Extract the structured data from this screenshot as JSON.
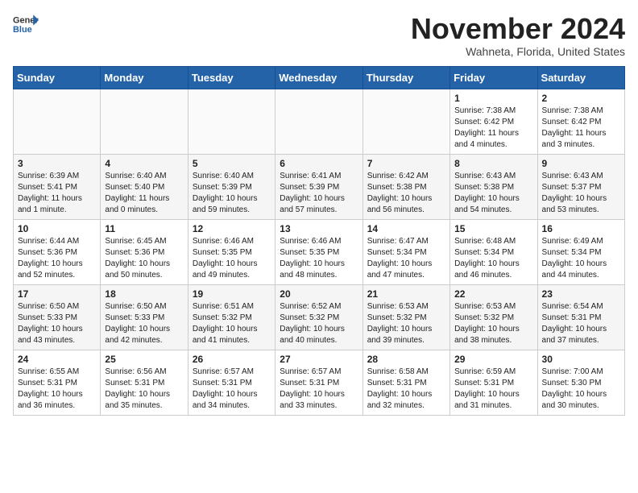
{
  "header": {
    "logo_general": "General",
    "logo_blue": "Blue",
    "month_title": "November 2024",
    "location": "Wahneta, Florida, United States"
  },
  "weekdays": [
    "Sunday",
    "Monday",
    "Tuesday",
    "Wednesday",
    "Thursday",
    "Friday",
    "Saturday"
  ],
  "weeks": [
    [
      {
        "day": "",
        "info": ""
      },
      {
        "day": "",
        "info": ""
      },
      {
        "day": "",
        "info": ""
      },
      {
        "day": "",
        "info": ""
      },
      {
        "day": "",
        "info": ""
      },
      {
        "day": "1",
        "info": "Sunrise: 7:38 AM\nSunset: 6:42 PM\nDaylight: 11 hours\nand 4 minutes."
      },
      {
        "day": "2",
        "info": "Sunrise: 7:38 AM\nSunset: 6:42 PM\nDaylight: 11 hours\nand 3 minutes."
      }
    ],
    [
      {
        "day": "3",
        "info": "Sunrise: 6:39 AM\nSunset: 5:41 PM\nDaylight: 11 hours\nand 1 minute."
      },
      {
        "day": "4",
        "info": "Sunrise: 6:40 AM\nSunset: 5:40 PM\nDaylight: 11 hours\nand 0 minutes."
      },
      {
        "day": "5",
        "info": "Sunrise: 6:40 AM\nSunset: 5:39 PM\nDaylight: 10 hours\nand 59 minutes."
      },
      {
        "day": "6",
        "info": "Sunrise: 6:41 AM\nSunset: 5:39 PM\nDaylight: 10 hours\nand 57 minutes."
      },
      {
        "day": "7",
        "info": "Sunrise: 6:42 AM\nSunset: 5:38 PM\nDaylight: 10 hours\nand 56 minutes."
      },
      {
        "day": "8",
        "info": "Sunrise: 6:43 AM\nSunset: 5:38 PM\nDaylight: 10 hours\nand 54 minutes."
      },
      {
        "day": "9",
        "info": "Sunrise: 6:43 AM\nSunset: 5:37 PM\nDaylight: 10 hours\nand 53 minutes."
      }
    ],
    [
      {
        "day": "10",
        "info": "Sunrise: 6:44 AM\nSunset: 5:36 PM\nDaylight: 10 hours\nand 52 minutes."
      },
      {
        "day": "11",
        "info": "Sunrise: 6:45 AM\nSunset: 5:36 PM\nDaylight: 10 hours\nand 50 minutes."
      },
      {
        "day": "12",
        "info": "Sunrise: 6:46 AM\nSunset: 5:35 PM\nDaylight: 10 hours\nand 49 minutes."
      },
      {
        "day": "13",
        "info": "Sunrise: 6:46 AM\nSunset: 5:35 PM\nDaylight: 10 hours\nand 48 minutes."
      },
      {
        "day": "14",
        "info": "Sunrise: 6:47 AM\nSunset: 5:34 PM\nDaylight: 10 hours\nand 47 minutes."
      },
      {
        "day": "15",
        "info": "Sunrise: 6:48 AM\nSunset: 5:34 PM\nDaylight: 10 hours\nand 46 minutes."
      },
      {
        "day": "16",
        "info": "Sunrise: 6:49 AM\nSunset: 5:34 PM\nDaylight: 10 hours\nand 44 minutes."
      }
    ],
    [
      {
        "day": "17",
        "info": "Sunrise: 6:50 AM\nSunset: 5:33 PM\nDaylight: 10 hours\nand 43 minutes."
      },
      {
        "day": "18",
        "info": "Sunrise: 6:50 AM\nSunset: 5:33 PM\nDaylight: 10 hours\nand 42 minutes."
      },
      {
        "day": "19",
        "info": "Sunrise: 6:51 AM\nSunset: 5:32 PM\nDaylight: 10 hours\nand 41 minutes."
      },
      {
        "day": "20",
        "info": "Sunrise: 6:52 AM\nSunset: 5:32 PM\nDaylight: 10 hours\nand 40 minutes."
      },
      {
        "day": "21",
        "info": "Sunrise: 6:53 AM\nSunset: 5:32 PM\nDaylight: 10 hours\nand 39 minutes."
      },
      {
        "day": "22",
        "info": "Sunrise: 6:53 AM\nSunset: 5:32 PM\nDaylight: 10 hours\nand 38 minutes."
      },
      {
        "day": "23",
        "info": "Sunrise: 6:54 AM\nSunset: 5:31 PM\nDaylight: 10 hours\nand 37 minutes."
      }
    ],
    [
      {
        "day": "24",
        "info": "Sunrise: 6:55 AM\nSunset: 5:31 PM\nDaylight: 10 hours\nand 36 minutes."
      },
      {
        "day": "25",
        "info": "Sunrise: 6:56 AM\nSunset: 5:31 PM\nDaylight: 10 hours\nand 35 minutes."
      },
      {
        "day": "26",
        "info": "Sunrise: 6:57 AM\nSunset: 5:31 PM\nDaylight: 10 hours\nand 34 minutes."
      },
      {
        "day": "27",
        "info": "Sunrise: 6:57 AM\nSunset: 5:31 PM\nDaylight: 10 hours\nand 33 minutes."
      },
      {
        "day": "28",
        "info": "Sunrise: 6:58 AM\nSunset: 5:31 PM\nDaylight: 10 hours\nand 32 minutes."
      },
      {
        "day": "29",
        "info": "Sunrise: 6:59 AM\nSunset: 5:31 PM\nDaylight: 10 hours\nand 31 minutes."
      },
      {
        "day": "30",
        "info": "Sunrise: 7:00 AM\nSunset: 5:30 PM\nDaylight: 10 hours\nand 30 minutes."
      }
    ]
  ]
}
